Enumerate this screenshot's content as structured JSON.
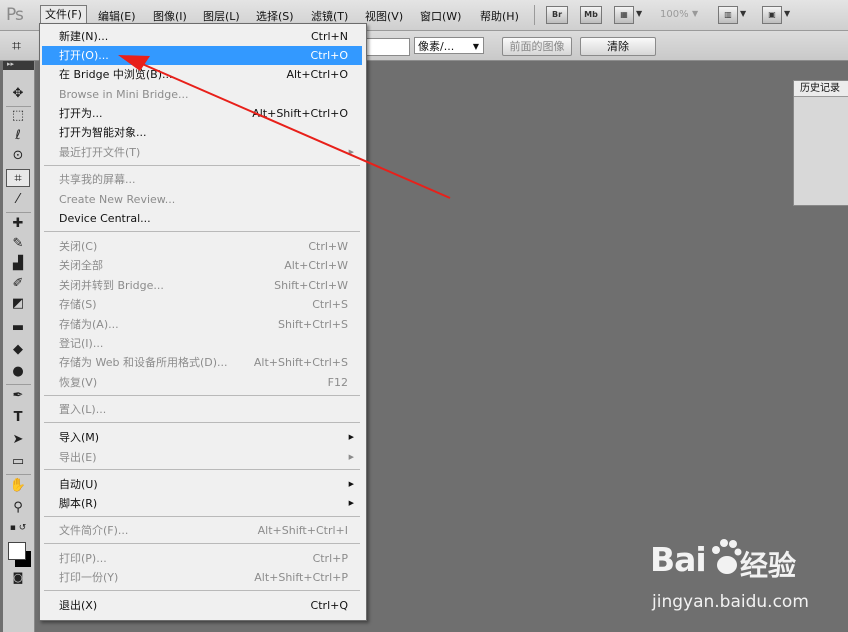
{
  "app": {
    "logo": "Ps"
  },
  "menubar": {
    "items": [
      "文件(F)",
      "编辑(E)",
      "图像(I)",
      "图层(L)",
      "选择(S)",
      "滤镜(T)",
      "视图(V)",
      "窗口(W)",
      "帮助(H)"
    ],
    "bridge_btn": "Br",
    "minibridge_btn": "Mb",
    "zoom": "100%"
  },
  "options": {
    "units": "像素/...",
    "front_image": "前面的图像",
    "clear": "清除"
  },
  "history_panel": {
    "title": "历史记录"
  },
  "file_menu": {
    "items": [
      {
        "label": "新建(N)...",
        "shortcut": "Ctrl+N",
        "disabled": false
      },
      {
        "label": "打开(O)...",
        "shortcut": "Ctrl+O",
        "disabled": false,
        "highlighted": true
      },
      {
        "label": "在 Bridge 中浏览(B)...",
        "shortcut": "Alt+Ctrl+O",
        "disabled": false
      },
      {
        "label": "Browse in Mini Bridge...",
        "shortcut": "",
        "disabled": true
      },
      {
        "label": "打开为...",
        "shortcut": "Alt+Shift+Ctrl+O",
        "disabled": false
      },
      {
        "label": "打开为智能对象...",
        "shortcut": "",
        "disabled": false
      },
      {
        "label": "最近打开文件(T)",
        "shortcut": "",
        "disabled": true,
        "submenu": true
      },
      {
        "label": "共享我的屏幕...",
        "shortcut": "",
        "disabled": true
      },
      {
        "label": "Create New Review...",
        "shortcut": "",
        "disabled": true
      },
      {
        "label": "Device Central...",
        "shortcut": "",
        "disabled": false
      },
      {
        "label": "关闭(C)",
        "shortcut": "Ctrl+W",
        "disabled": true
      },
      {
        "label": "关闭全部",
        "shortcut": "Alt+Ctrl+W",
        "disabled": true
      },
      {
        "label": "关闭并转到 Bridge...",
        "shortcut": "Shift+Ctrl+W",
        "disabled": true
      },
      {
        "label": "存储(S)",
        "shortcut": "Ctrl+S",
        "disabled": true
      },
      {
        "label": "存储为(A)...",
        "shortcut": "Shift+Ctrl+S",
        "disabled": true
      },
      {
        "label": "登记(I)...",
        "shortcut": "",
        "disabled": true
      },
      {
        "label": "存储为 Web 和设备所用格式(D)...",
        "shortcut": "Alt+Shift+Ctrl+S",
        "disabled": true
      },
      {
        "label": "恢复(V)",
        "shortcut": "F12",
        "disabled": true
      },
      {
        "label": "置入(L)...",
        "shortcut": "",
        "disabled": true
      },
      {
        "label": "导入(M)",
        "shortcut": "",
        "disabled": false,
        "submenu": true
      },
      {
        "label": "导出(E)",
        "shortcut": "",
        "disabled": true,
        "submenu": true
      },
      {
        "label": "自动(U)",
        "shortcut": "",
        "disabled": false,
        "submenu": true
      },
      {
        "label": "脚本(R)",
        "shortcut": "",
        "disabled": false,
        "submenu": true
      },
      {
        "label": "文件简介(F)...",
        "shortcut": "Alt+Shift+Ctrl+I",
        "disabled": true
      },
      {
        "label": "打印(P)...",
        "shortcut": "Ctrl+P",
        "disabled": true
      },
      {
        "label": "打印一份(Y)",
        "shortcut": "Alt+Shift+Ctrl+P",
        "disabled": true
      },
      {
        "label": "退出(X)",
        "shortcut": "Ctrl+Q",
        "disabled": false
      }
    ]
  },
  "icons": {
    "tools": [
      "move-icon",
      "marquee-icon",
      "lasso-icon",
      "quick-select-icon",
      "crop-icon",
      "eyedropper-icon",
      "spot-heal-icon",
      "brush-icon",
      "clone-stamp-icon",
      "history-brush-icon",
      "eraser-icon",
      "gradient-icon",
      "blur-icon",
      "dodge-icon",
      "pen-icon",
      "type-icon",
      "path-select-icon",
      "shape-icon",
      "hand-icon",
      "zoom-icon"
    ]
  },
  "colors": {
    "highlight": "#3399ff",
    "arrow": "#e8201a",
    "canvas": "#6f6f6f"
  },
  "watermark": {
    "brand": "Bai",
    "brand_cn": "经验",
    "url": "jingyan.baidu.com"
  }
}
